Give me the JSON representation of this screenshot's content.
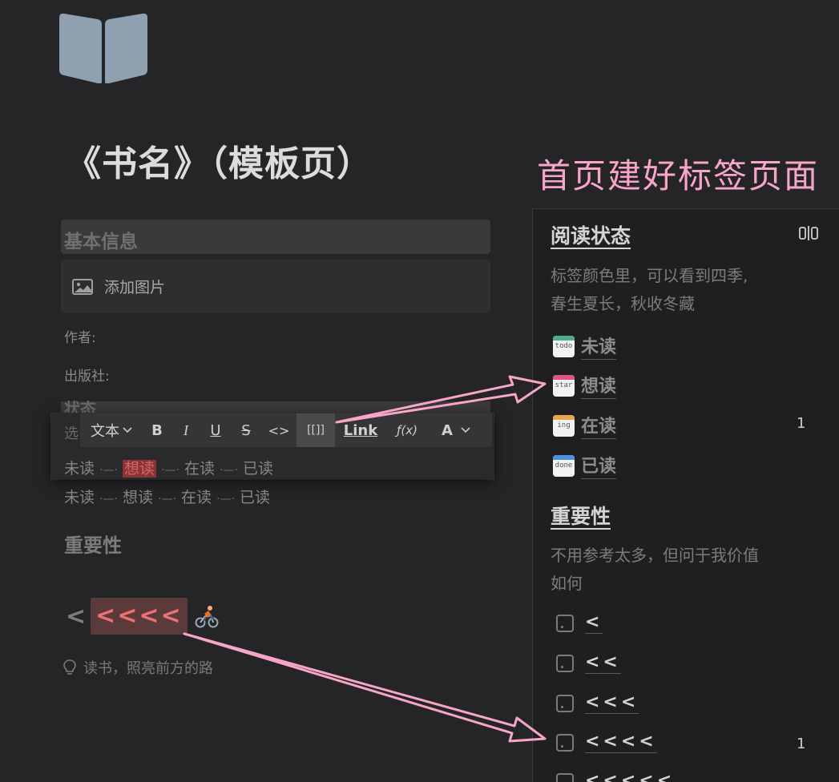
{
  "page": {
    "icon": "open-book-icon",
    "title": "《书名》（模板页）"
  },
  "info": {
    "heading": "基本信息",
    "add_image": "添加图片",
    "author_label": "作者:",
    "publisher_label": "出版社:",
    "status_heading_partial": "状态",
    "select_prefix": "选"
  },
  "toolbar": {
    "text_dropdown": "文本",
    "bold": "B",
    "italic": "I",
    "underline": "U",
    "strike": "S",
    "code": "<>",
    "page_link": "[[]]",
    "link": "Link",
    "formula": "ƒ(x)",
    "color": "A"
  },
  "status_flow": {
    "items": [
      "未读",
      "想读",
      "在读",
      "已读"
    ],
    "highlighted": "想读",
    "separator": "·—·"
  },
  "importance": {
    "heading": "重要性",
    "dim_mark": "<",
    "active_marks": "<<<<"
  },
  "tip": "读书，照亮前方的路",
  "annotation": "首页建好标签页面",
  "sidebar": {
    "reading_status": {
      "heading": "阅读状态",
      "description_line1": "标签颜色里，可以看到四季,",
      "description_line2": "春生夏长，秋收冬藏",
      "items": [
        {
          "tag": "todo",
          "label": "未读",
          "color": "#4caf87",
          "count": ""
        },
        {
          "tag": "star",
          "label": "想读",
          "color": "#e0577e",
          "count": ""
        },
        {
          "tag": "ing",
          "label": "在读",
          "color": "#e7a64a",
          "count": "1"
        },
        {
          "tag": "done",
          "label": "已读",
          "color": "#4b92d6",
          "count": ""
        }
      ]
    },
    "importance": {
      "heading": "重要性",
      "description_line1": "不用参考太多，但问于我价值",
      "description_line2": "如何",
      "items": [
        {
          "label": "<",
          "count": ""
        },
        {
          "label": "<<",
          "count": ""
        },
        {
          "label": "<<<",
          "count": ""
        },
        {
          "label": "<<<<",
          "count": "1"
        },
        {
          "label": "<<<<<",
          "count": ""
        }
      ]
    }
  },
  "colors": {
    "background": "#252527",
    "sidebar": "#1f1f21",
    "annotation_pink": "#f7a6c6",
    "rating_red": "#ec7272"
  }
}
